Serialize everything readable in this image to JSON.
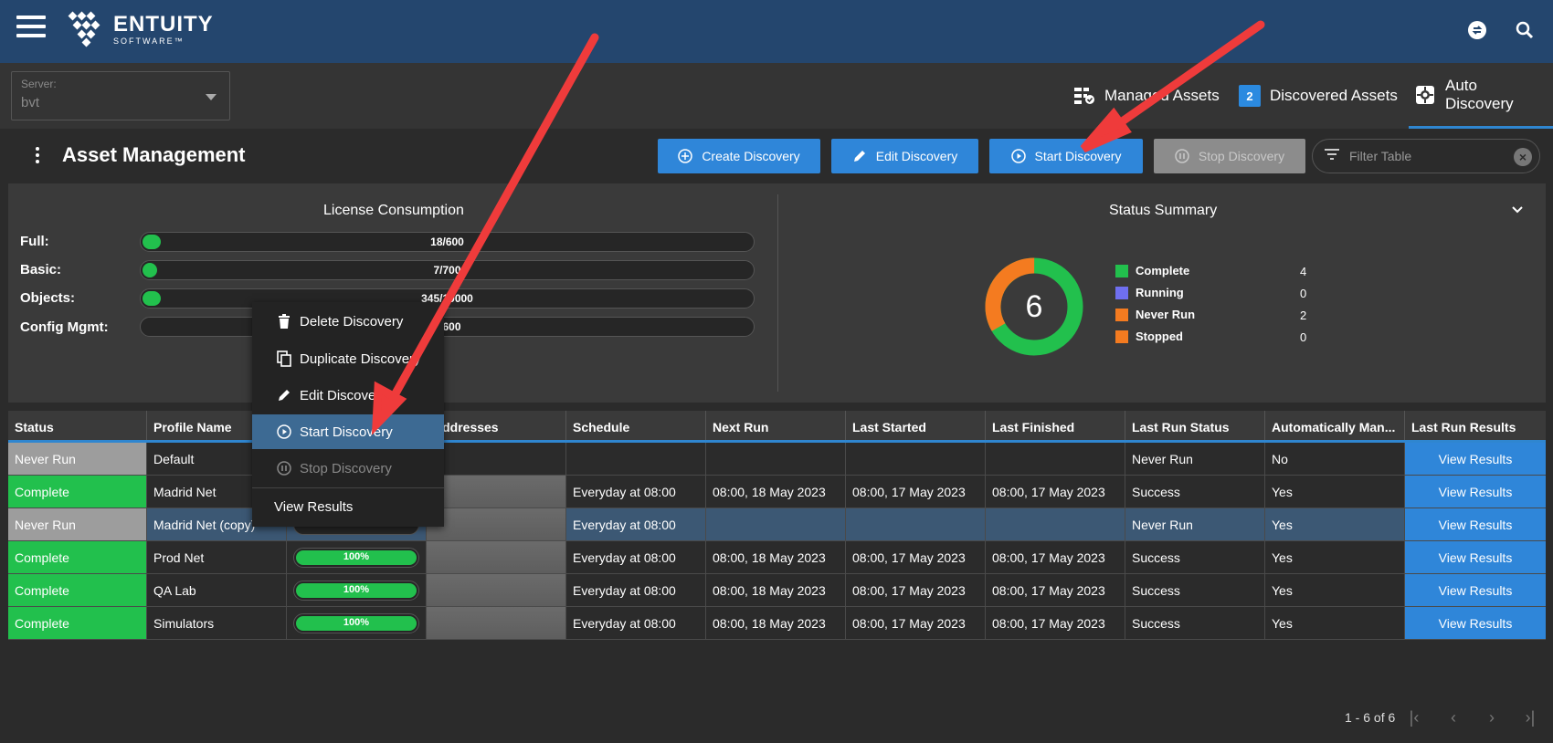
{
  "header": {
    "logo_name": "ENTUITY",
    "logo_sub": "SOFTWARE™",
    "colors": {
      "topbar": "#24466e",
      "accent": "#2f86d9"
    }
  },
  "server": {
    "label": "Server:",
    "value": "bvt"
  },
  "top_tabs": [
    {
      "label": "Managed Assets",
      "icon": "managed-assets-icon"
    },
    {
      "label": "Discovered Assets",
      "badge": "2"
    },
    {
      "label": "Auto Discovery",
      "icon": "auto-discovery-icon",
      "active": true
    }
  ],
  "page": {
    "title": "Asset Management"
  },
  "toolbar": {
    "create": "Create Discovery",
    "edit": "Edit Discovery",
    "start": "Start Discovery",
    "stop": "Stop Discovery",
    "filter_placeholder": "Filter Table"
  },
  "license": {
    "title": "License Consumption",
    "rows": [
      {
        "label": "Full:",
        "text": "18/600",
        "fraction": 0.03
      },
      {
        "label": "Basic:",
        "text": "7/700",
        "fraction": 0.01
      },
      {
        "label": "Objects:",
        "text": "345/10000",
        "fraction": 0.03
      },
      {
        "label": "Config Mgmt:",
        "text": "0/600",
        "fraction": 0
      }
    ]
  },
  "status_summary": {
    "title": "Status Summary",
    "total": "6",
    "items": [
      {
        "label": "Complete",
        "count": "4",
        "color": "#22c04d"
      },
      {
        "label": "Running",
        "count": "0",
        "color": "#6f6ff0"
      },
      {
        "label": "Never Run",
        "count": "2",
        "color": "#f47b20"
      },
      {
        "label": "Stopped",
        "count": "0",
        "color": "#f47b20"
      }
    ]
  },
  "table": {
    "columns": [
      "Status",
      "Profile Name",
      "",
      "Addresses",
      "Schedule",
      "Next Run",
      "Last Started",
      "Last Finished",
      "Last Run Status",
      "Automatically Man...",
      "Last Run Results"
    ],
    "rows": [
      {
        "status": "Never Run",
        "name": "Default",
        "progress": "",
        "schedule": "",
        "next": "",
        "started": "",
        "finished": "",
        "last_status": "Never Run",
        "auto": "No",
        "results": "View Results"
      },
      {
        "status": "Complete",
        "name": "Madrid Net",
        "progress": "",
        "schedule": "Everyday at 08:00",
        "next": "08:00, 18 May 2023",
        "started": "08:00, 17 May 2023",
        "finished": "08:00, 17 May 2023",
        "last_status": "Success",
        "auto": "Yes",
        "results": "View Results"
      },
      {
        "status": "Never Run",
        "name": "Madrid Net (copy)",
        "progress": "0%",
        "schedule": "Everyday at 08:00",
        "next": "",
        "started": "",
        "finished": "",
        "last_status": "Never Run",
        "auto": "Yes",
        "results": "View Results"
      },
      {
        "status": "Complete",
        "name": "Prod Net",
        "progress": "100%",
        "schedule": "Everyday at 08:00",
        "next": "08:00, 18 May 2023",
        "started": "08:00, 17 May 2023",
        "finished": "08:00, 17 May 2023",
        "last_status": "Success",
        "auto": "Yes",
        "results": "View Results"
      },
      {
        "status": "Complete",
        "name": "QA Lab",
        "progress": "100%",
        "schedule": "Everyday at 08:00",
        "next": "08:00, 18 May 2023",
        "started": "08:00, 17 May 2023",
        "finished": "08:00, 17 May 2023",
        "last_status": "Success",
        "auto": "Yes",
        "results": "View Results"
      },
      {
        "status": "Complete",
        "name": "Simulators",
        "progress": "100%",
        "schedule": "Everyday at 08:00",
        "next": "08:00, 18 May 2023",
        "started": "08:00, 17 May 2023",
        "finished": "08:00, 17 May 2023",
        "last_status": "Success",
        "auto": "Yes",
        "results": "View Results"
      }
    ]
  },
  "context_menu": {
    "delete": "Delete Discovery",
    "duplicate": "Duplicate Discovery",
    "edit": "Edit Discovery",
    "start": "Start Discovery",
    "stop": "Stop Discovery",
    "view": "View Results"
  },
  "pager": {
    "text": "1 - 6 of 6"
  }
}
